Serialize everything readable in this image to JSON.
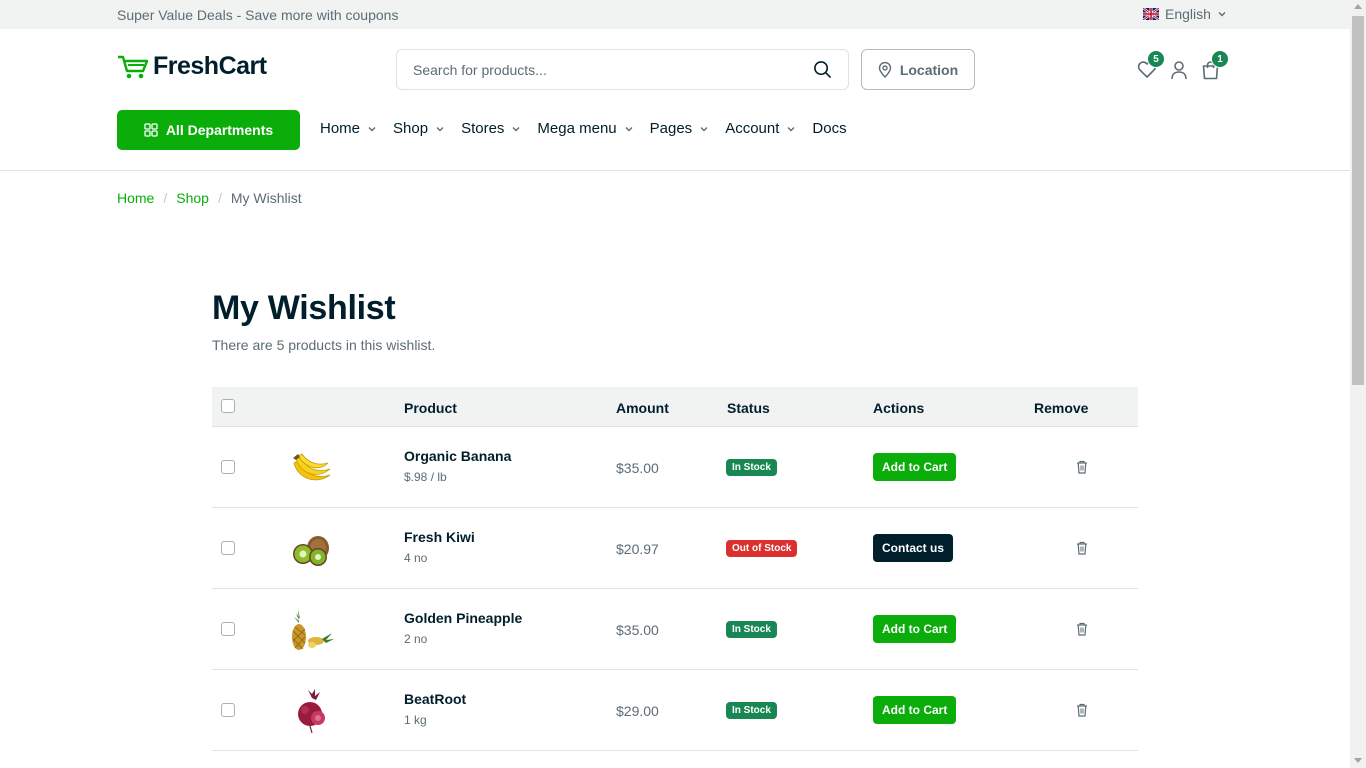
{
  "topbar": {
    "promo": "Super Value Deals - Save more with coupons",
    "language": "English"
  },
  "header": {
    "brand": "FreshCart",
    "search_placeholder": "Search for products...",
    "location_label": "Location",
    "wishlist_count": "5",
    "cart_count": "1"
  },
  "nav": {
    "departments_label": "All Departments",
    "items": [
      {
        "label": "Home",
        "dropdown": true
      },
      {
        "label": "Shop",
        "dropdown": true
      },
      {
        "label": "Stores",
        "dropdown": true
      },
      {
        "label": "Mega menu",
        "dropdown": true
      },
      {
        "label": "Pages",
        "dropdown": true
      },
      {
        "label": "Account",
        "dropdown": true
      },
      {
        "label": "Docs",
        "dropdown": false
      }
    ]
  },
  "breadcrumb": {
    "items": [
      "Home",
      "Shop"
    ],
    "current": "My Wishlist"
  },
  "page": {
    "title": "My Wishlist",
    "subtitle": "There are 5 products in this wishlist."
  },
  "table": {
    "headers": {
      "product": "Product",
      "amount": "Amount",
      "status": "Status",
      "actions": "Actions",
      "remove": "Remove"
    },
    "rows": [
      {
        "name": "Organic Banana",
        "unit": "$.98 / lb",
        "amount": "$35.00",
        "status": "In Stock",
        "in_stock": true,
        "action": "Add to Cart",
        "image": "banana"
      },
      {
        "name": "Fresh Kiwi",
        "unit": "4 no",
        "amount": "$20.97",
        "status": "Out of Stock",
        "in_stock": false,
        "action": "Contact us",
        "image": "kiwi"
      },
      {
        "name": "Golden Pineapple",
        "unit": "2 no",
        "amount": "$35.00",
        "status": "In Stock",
        "in_stock": true,
        "action": "Add to Cart",
        "image": "pineapple"
      },
      {
        "name": "BeatRoot",
        "unit": "1 kg",
        "amount": "$29.00",
        "status": "In Stock",
        "in_stock": true,
        "action": "Add to Cart",
        "image": "beetroot"
      }
    ]
  },
  "colors": {
    "primary": "#0aad0a",
    "dark": "#001e2b",
    "success": "#198754",
    "danger": "#db3030",
    "muted": "#5c6c75"
  }
}
